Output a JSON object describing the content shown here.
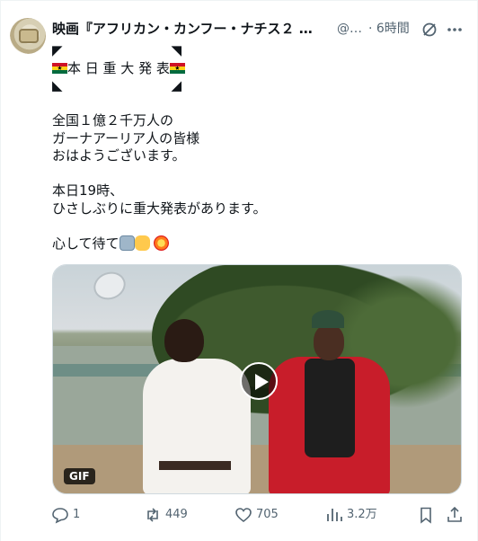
{
  "tweet": {
    "display_name": "映画『アフリカン・カンフー・ナチス２",
    "ellipsis": "…",
    "handle": "@…",
    "time": "· 6時間",
    "lines": {
      "title": "本 日 重 大 発 表",
      "l1": "全国１億２千万人の",
      "l2": "ガーナアーリア人の皆様",
      "l3": "おはようございます。",
      "l4": "本日19時、",
      "l5": "ひさしぶりに重大発表があります。",
      "l6": "心して待て"
    },
    "media": {
      "badge": "GIF"
    },
    "stats": {
      "replies": "1",
      "reposts": "449",
      "likes": "705",
      "views": "3.2万"
    }
  },
  "icons": [
    "grok-icon",
    "more-icon",
    "play-icon",
    "reply-icon",
    "repost-icon",
    "like-icon",
    "views-icon",
    "bookmark-icon",
    "share-icon"
  ],
  "colors": {
    "text": "#0f1419",
    "muted": "#536471",
    "border": "#cfd9de"
  }
}
